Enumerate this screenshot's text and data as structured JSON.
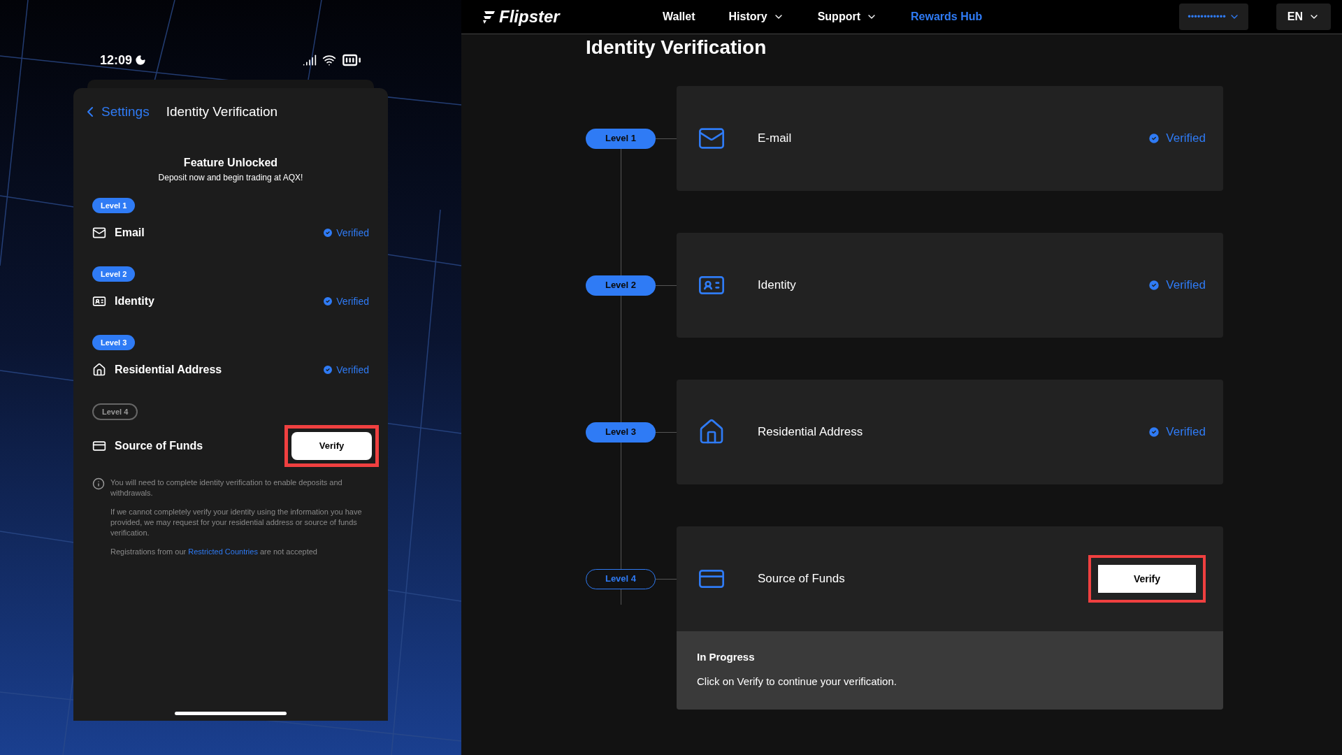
{
  "phone": {
    "status_time": "12:09",
    "back_label": "Settings",
    "title": "Identity Verification",
    "unlocked_title": "Feature Unlocked",
    "unlocked_subtitle": "Deposit now and begin trading at AQX!",
    "levels": [
      {
        "badge": "Level 1",
        "name": "Email",
        "kind": "email",
        "completed": true,
        "status": "Verified"
      },
      {
        "badge": "Level 2",
        "name": "Identity",
        "kind": "identity",
        "completed": true,
        "status": "Verified"
      },
      {
        "badge": "Level 3",
        "name": "Residential Address",
        "kind": "address",
        "completed": true,
        "status": "Verified"
      },
      {
        "badge": "Level 4",
        "name": "Source of Funds",
        "kind": "funds",
        "completed": false,
        "action": "Verify",
        "highlighted": true
      }
    ],
    "notes": [
      {
        "text": "You will need to complete identity verification to enable deposits and withdrawals."
      },
      {
        "text": "If we cannot completely verify your identity using the information you have provided, we may request for your residential address or source of funds verification."
      },
      {
        "text": "Registrations from our ",
        "link": "Restricted Countries",
        "after": " are not accepted"
      }
    ]
  },
  "web": {
    "logo": "Flipster",
    "nav": [
      {
        "label": "Wallet",
        "dropdown": false,
        "selected": false
      },
      {
        "label": "History",
        "dropdown": true,
        "selected": false
      },
      {
        "label": "Support",
        "dropdown": true,
        "selected": false
      },
      {
        "label": "Rewards Hub",
        "dropdown": false,
        "selected": true
      }
    ],
    "account": "••••••••••••",
    "language": "EN",
    "heading": "Identity Verification",
    "levels": [
      {
        "badge": "Level 1",
        "name": "E-mail",
        "kind": "email",
        "completed": true,
        "status": "Verified"
      },
      {
        "badge": "Level 2",
        "name": "Identity",
        "kind": "identity",
        "completed": true,
        "status": "Verified"
      },
      {
        "badge": "Level 3",
        "name": "Residential Address",
        "kind": "address",
        "completed": true,
        "status": "Verified"
      },
      {
        "badge": "Level 4",
        "name": "Source of Funds",
        "kind": "funds",
        "completed": false,
        "action": "Verify",
        "highlighted": true,
        "progress_title": "In Progress",
        "progress_text": "Click on Verify to continue your verification."
      }
    ]
  }
}
